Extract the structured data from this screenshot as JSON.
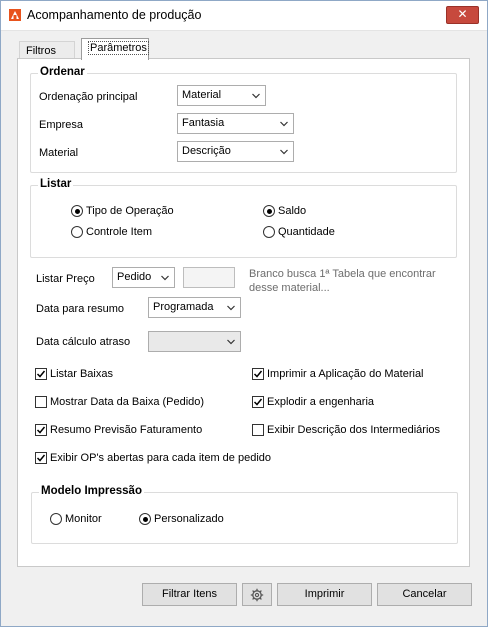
{
  "window": {
    "title": "Acompanhamento de produção",
    "close_label": "✕"
  },
  "tabs": [
    {
      "label": "Filtros",
      "selected": false
    },
    {
      "label": "Parâmetros",
      "selected": true
    }
  ],
  "ordenar": {
    "title": "Ordenar",
    "ordenacao_principal": {
      "label": "Ordenação principal",
      "value": "Material"
    },
    "empresa": {
      "label": "Empresa",
      "value": "Fantasia"
    },
    "material": {
      "label": "Material",
      "value": "Descrição"
    }
  },
  "listar": {
    "title": "Listar",
    "options": [
      {
        "label": "Tipo de Operação",
        "selected": true
      },
      {
        "label": "Controle Item",
        "selected": false
      },
      {
        "label": "Saldo",
        "selected": true
      },
      {
        "label": "Quantidade",
        "selected": false
      }
    ]
  },
  "listar_preco": {
    "label": "Listar Preço",
    "value": "Pedido",
    "text_value": "",
    "hint_line1": "Branco busca 1ª Tabela que encontrar",
    "hint_line2": "desse material..."
  },
  "data_resumo": {
    "label": "Data para resumo",
    "value": "Programada"
  },
  "data_atraso": {
    "label": "Data cálculo atraso",
    "value": ""
  },
  "checkboxes": [
    {
      "label": "Listar Baixas",
      "checked": true
    },
    {
      "label": "Imprimir a Aplicação do Material",
      "checked": true
    },
    {
      "label": "Mostrar Data da Baixa (Pedido)",
      "checked": false
    },
    {
      "label": "Explodir a engenharia",
      "checked": true
    },
    {
      "label": "Resumo Previsão Faturamento",
      "checked": true
    },
    {
      "label": "Exibir Descrição dos Intermediários",
      "checked": false
    },
    {
      "label": "Exibir OP's abertas para cada item de pedido",
      "checked": true
    }
  ],
  "modelo": {
    "title": "Modelo Impressão",
    "options": [
      {
        "label": "Monitor",
        "selected": false
      },
      {
        "label": "Personalizado",
        "selected": true
      }
    ]
  },
  "buttons": {
    "filtrar": "Filtrar Itens",
    "imprimir": "Imprimir",
    "cancelar": "Cancelar"
  }
}
